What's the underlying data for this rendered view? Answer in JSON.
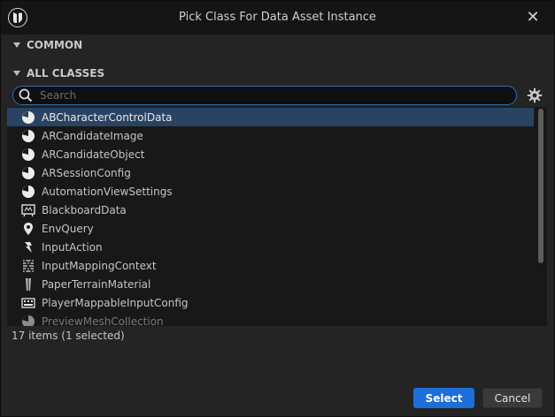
{
  "window": {
    "title": "Pick Class For Data Asset Instance"
  },
  "sections": {
    "common": "COMMON",
    "all_classes": "ALL CLASSES"
  },
  "search": {
    "placeholder": "Search",
    "value": ""
  },
  "items": [
    {
      "label": "ABCharacterControlData",
      "icon": "pie-icon",
      "selected": true
    },
    {
      "label": "ARCandidateImage",
      "icon": "pie-icon"
    },
    {
      "label": "ARCandidateObject",
      "icon": "pie-icon"
    },
    {
      "label": "ARSessionConfig",
      "icon": "pie-icon"
    },
    {
      "label": "AutomationViewSettings",
      "icon": "pie-icon"
    },
    {
      "label": "BlackboardData",
      "icon": "blackboard-icon"
    },
    {
      "label": "EnvQuery",
      "icon": "location-pin-icon"
    },
    {
      "label": "InputAction",
      "icon": "input-action-icon"
    },
    {
      "label": "InputMappingContext",
      "icon": "mapping-context-icon"
    },
    {
      "label": "PaperTerrainMaterial",
      "icon": "paper-terrain-icon"
    },
    {
      "label": "PlayerMappableInputConfig",
      "icon": "keyboard-icon"
    },
    {
      "label": "PreviewMeshCollection",
      "icon": "pie-icon"
    }
  ],
  "status": {
    "text": "17 items (1 selected)"
  },
  "buttons": {
    "select": "Select",
    "cancel": "Cancel"
  },
  "colors": {
    "accent": "#1c6fd8",
    "selection": "#294463",
    "search_border": "#2f6fb0"
  }
}
